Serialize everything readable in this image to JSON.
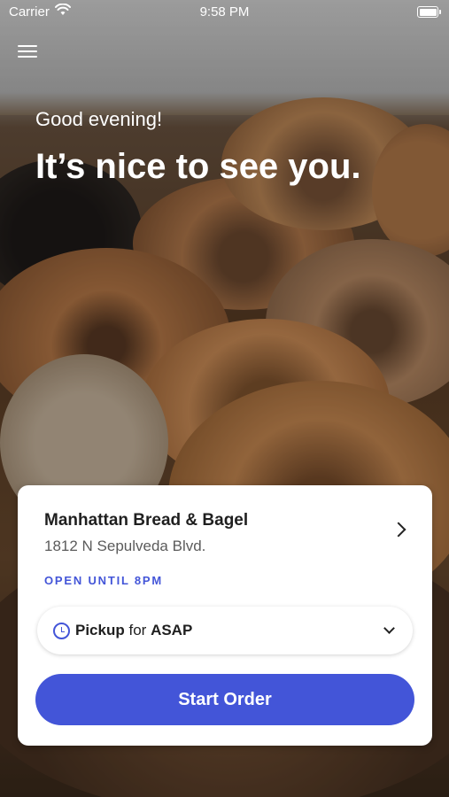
{
  "status_bar": {
    "carrier": "Carrier",
    "time": "9:58 PM",
    "wifi_icon": "wifi-icon",
    "battery_icon": "battery-icon"
  },
  "header": {
    "menu_icon": "hamburger-menu-icon",
    "greeting": "Good evening!",
    "headline": "It’s nice to see you."
  },
  "store_card": {
    "name": "Manhattan Bread & Bagel",
    "address": "1812 N Sepulveda Blvd.",
    "hours": "OPEN UNTIL 8PM",
    "chevron_icon": "chevron-right-icon",
    "order_type": {
      "icon": "clock-icon",
      "mode": "Pickup",
      "connector": "for",
      "time": "ASAP",
      "dropdown_icon": "chevron-down-icon"
    },
    "start_order_label": "Start Order"
  },
  "colors": {
    "accent": "#4355d8",
    "card_background": "#ffffff",
    "text_primary": "#1f1f1f",
    "text_secondary": "#5b5b5b"
  }
}
